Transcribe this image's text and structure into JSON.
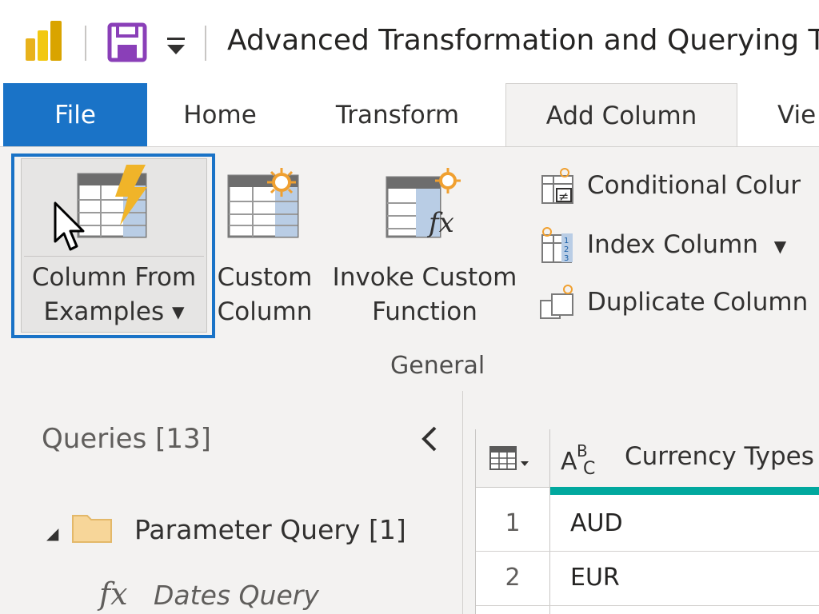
{
  "window": {
    "title": "Advanced Transformation and Querying Tec"
  },
  "tabs": [
    {
      "label": "File"
    },
    {
      "label": "Home"
    },
    {
      "label": "Transform"
    },
    {
      "label": "Add Column"
    },
    {
      "label": "Vie"
    }
  ],
  "ribbon": {
    "column_from_examples": {
      "line1": "Column From",
      "line2": "Examples ▾"
    },
    "custom_column": {
      "line1": "Custom",
      "line2": "Column"
    },
    "invoke_custom_function": {
      "line1": "Invoke Custom",
      "line2": "Function"
    },
    "conditional_column": "Conditional Colur",
    "index_column": "Index Column",
    "duplicate_column": "Duplicate Column",
    "group_label": "General"
  },
  "queries": {
    "title": "Queries [13]",
    "items": [
      {
        "label": "Parameter Query [1]",
        "type": "folder"
      },
      {
        "label": "Dates Query",
        "type": "function"
      }
    ]
  },
  "grid": {
    "column_header": "Currency Types",
    "rows": [
      {
        "index": "1",
        "value": "AUD"
      },
      {
        "index": "2",
        "value": "EUR"
      }
    ]
  },
  "colors": {
    "file_tab": "#1a73c7",
    "highlight": "#1a73c7",
    "column_quality_bar": "#01a89e",
    "ribbon_bg": "#f3f2f1"
  },
  "icons": [
    "powerbi-logo-icon",
    "save-icon",
    "quick-access-dropdown-icon",
    "column-from-examples-icon",
    "mouse-cursor-icon",
    "custom-column-icon",
    "invoke-custom-function-icon",
    "conditional-column-icon",
    "index-column-icon",
    "duplicate-column-icon",
    "collapse-chevron-icon",
    "folder-icon",
    "function-icon",
    "table-type-icon",
    "text-type-icon"
  ]
}
